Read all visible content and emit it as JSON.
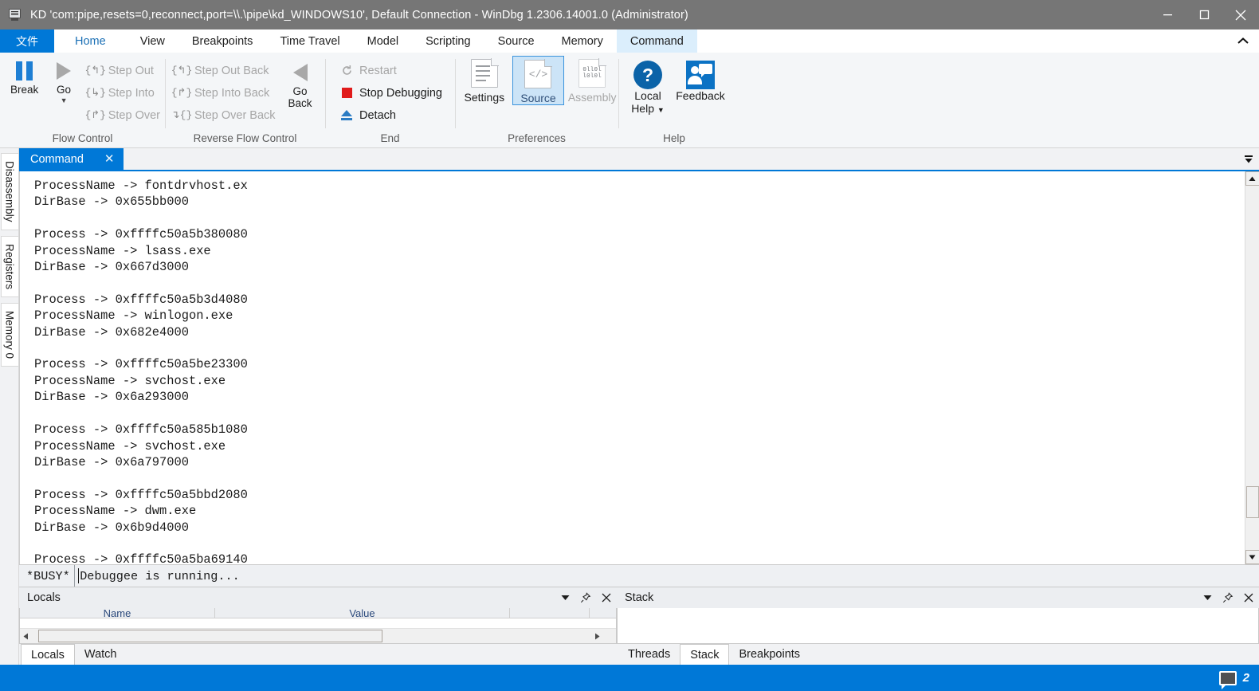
{
  "window": {
    "title": "KD 'com:pipe,resets=0,reconnect,port=\\\\.\\pipe\\kd_WINDOWS10', Default Connection  - WinDbg 1.2306.14001.0 (Administrator)",
    "icon": "debugger-icon",
    "minimize_label": "Minimize",
    "maximize_label": "Maximize",
    "close_label": "Close"
  },
  "ribbon": {
    "tabs": [
      {
        "label": "文件",
        "id": "file"
      },
      {
        "label": "Home",
        "id": "home"
      },
      {
        "label": "View",
        "id": "view"
      },
      {
        "label": "Breakpoints",
        "id": "breakpoints"
      },
      {
        "label": "Time Travel",
        "id": "time-travel"
      },
      {
        "label": "Model",
        "id": "model"
      },
      {
        "label": "Scripting",
        "id": "scripting"
      },
      {
        "label": "Source",
        "id": "source"
      },
      {
        "label": "Memory",
        "id": "memory"
      },
      {
        "label": "Command",
        "id": "command"
      }
    ],
    "collapse_icon": "chevron-up-icon",
    "groups": {
      "flow_control": {
        "label": "Flow Control",
        "break": "Break",
        "go": "Go",
        "step_out": "Step Out",
        "step_into": "Step Into",
        "step_over": "Step Over"
      },
      "reverse_flow_control": {
        "label": "Reverse Flow Control",
        "step_out_back": "Step Out Back",
        "step_into_back": "Step Into Back",
        "step_over_back": "Step Over Back",
        "go_back_line1": "Go",
        "go_back_line2": "Back"
      },
      "end": {
        "label": "End",
        "restart": "Restart",
        "stop_debugging": "Stop Debugging",
        "detach": "Detach"
      },
      "preferences": {
        "label": "Preferences",
        "settings": "Settings",
        "source": "Source",
        "assembly": "Assembly",
        "assembly_bits_line1": "0ll0l",
        "assembly_bits_line2": "l0l0l"
      },
      "help": {
        "label": "Help",
        "local_help_line1": "Local",
        "local_help_line2": "Help",
        "feedback": "Feedback"
      }
    }
  },
  "side_tabs": [
    {
      "label": "Disassembly"
    },
    {
      "label": "Registers"
    },
    {
      "label": "Memory 0"
    }
  ],
  "document": {
    "tab_label": "Command",
    "tab_close": "✕",
    "tab_list_icon": "tab-list-icon",
    "output": "ProcessName -> fontdrvhost.ex\nDirBase -> 0x655bb000\n\nProcess -> 0xffffc50a5b380080\nProcessName -> lsass.exe\nDirBase -> 0x667d3000\n\nProcess -> 0xffffc50a5b3d4080\nProcessName -> winlogon.exe\nDirBase -> 0x682e4000\n\nProcess -> 0xffffc50a5be23300\nProcessName -> svchost.exe\nDirBase -> 0x6a293000\n\nProcess -> 0xffffc50a585b1080\nProcessName -> svchost.exe\nDirBase -> 0x6a797000\n\nProcess -> 0xffffc50a5bbd2080\nProcessName -> dwm.exe\nDirBase -> 0x6b9d4000\n\nProcess -> 0xffffc50a5ba69140"
  },
  "command_input": {
    "busy_tag": "*BUSY*",
    "value": "Debuggee is running...",
    "placeholder": ""
  },
  "locals_panel": {
    "title": "Locals",
    "dropdown_icon": "chevron-down-icon",
    "pin_icon": "pin-icon",
    "close_icon": "close-icon",
    "columns": [
      "Name",
      "Value",
      ""
    ],
    "rows": [],
    "tabs": [
      {
        "label": "Locals",
        "active": true
      },
      {
        "label": "Watch",
        "active": false
      }
    ]
  },
  "stack_panel": {
    "title": "Stack",
    "dropdown_icon": "chevron-down-icon",
    "pin_icon": "pin-icon",
    "close_icon": "close-icon",
    "rows": [],
    "tabs": [
      {
        "label": "Threads",
        "active": false
      },
      {
        "label": "Stack",
        "active": true
      },
      {
        "label": "Breakpoints",
        "active": false
      }
    ]
  },
  "status_bar": {
    "notification_icon": "speech-bubble-icon",
    "notification_count": "2"
  },
  "colors": {
    "accent": "#0078d7",
    "titlebar": "#767676",
    "ribbon_bg": "#f4f6f8",
    "selected_tile": "#cce4f7",
    "stop_red": "#e01b1b"
  }
}
